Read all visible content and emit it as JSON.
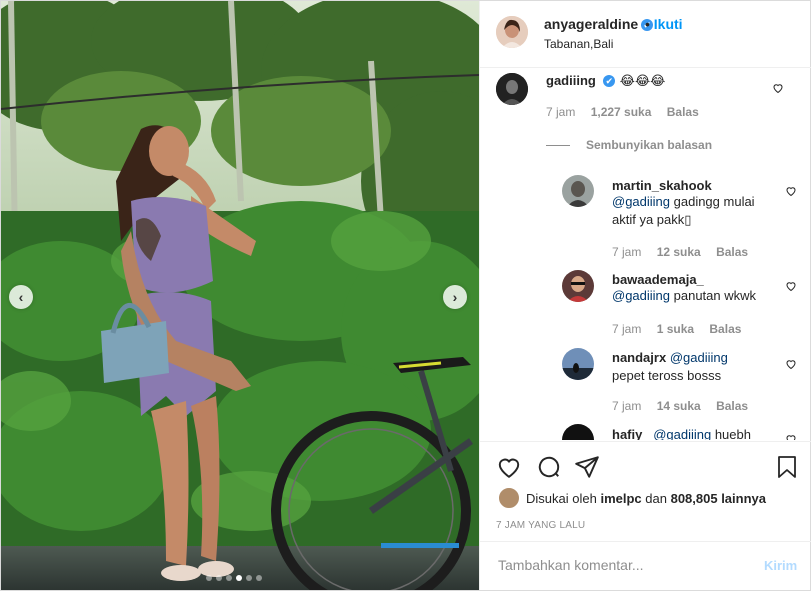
{
  "header": {
    "username": "anyageraldine",
    "verified_mark": "✔",
    "separator": "•",
    "follow_label": "Ikuti",
    "location": "Tabanan,Bali"
  },
  "comments": [
    {
      "username": "gadiiing",
      "verified_mark": "✔",
      "text": "😂😂😂",
      "time": "7 jam",
      "likes": "1,227 suka",
      "reply_label": "Balas"
    }
  ],
  "hide_replies_label": "Sembunyikan balasan",
  "replies": [
    {
      "username": "martin_skahook",
      "mention": "@gadiiing",
      "text": " gadingg mulai aktif ya pakk▯",
      "time": "7 jam",
      "likes": "12 suka",
      "reply_label": "Balas"
    },
    {
      "username": "bawaademaja_",
      "mention": "@gadiiing",
      "text": " panutan wkwk",
      "time": "7 jam",
      "likes": "1 suka",
      "reply_label": "Balas"
    },
    {
      "username": "nandajrx",
      "mention": "@gadiiing",
      "text": "pepet teross bosss",
      "time": "7 jam",
      "likes": "14 suka",
      "reply_label": "Balas"
    },
    {
      "username": "hafiy_",
      "mention": "@gadiiing",
      "text": " huebh"
    }
  ],
  "likes": {
    "prefix": "Disukai oleh",
    "user": "imelpc",
    "middle": "dan",
    "count": "808,805 lainnya"
  },
  "timestamp": "7 JAM YANG LALU",
  "add_comment": {
    "placeholder": "Tambahkan komentar...",
    "post_label": "Kirim"
  },
  "carousel": {
    "prev_icon": "‹",
    "next_icon": "›",
    "slide_count": 6,
    "active_slide": 4
  },
  "colors": {
    "accent": "#0095f6",
    "verified": "#3897f0",
    "muted": "#8e8e8e"
  }
}
